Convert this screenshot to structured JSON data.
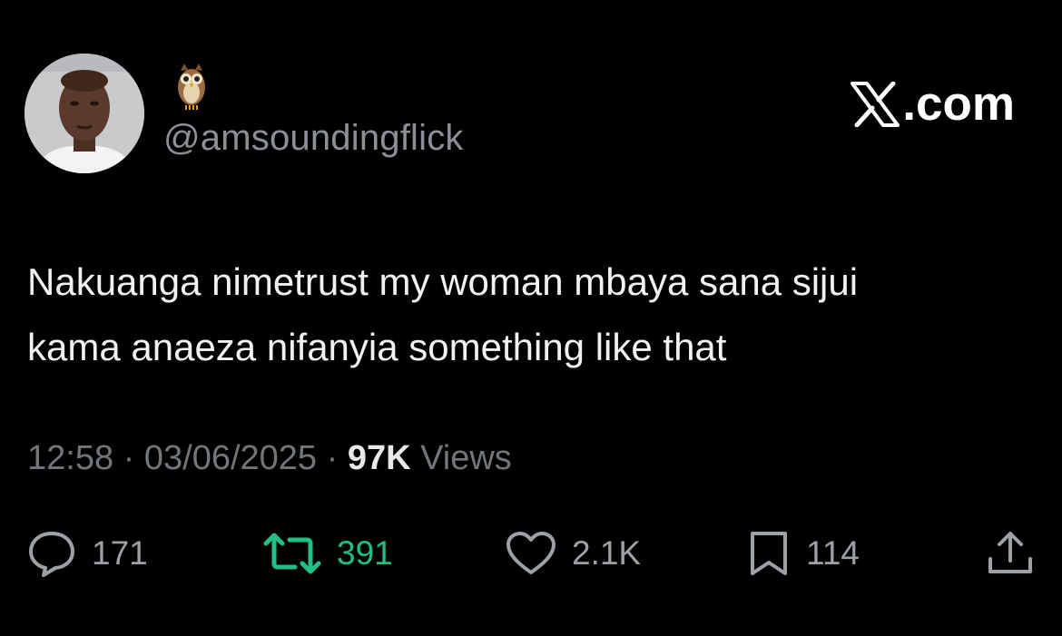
{
  "author": {
    "handle": "@amsoundingflick",
    "name_icon": "owl-emoji",
    "avatar": "avatar-photo"
  },
  "brand": {
    "logo_icon": "x-logo",
    "suffix": ".com"
  },
  "tweet": {
    "lines": [
      "Nakuanga nimetrust my woman mbaya sana sijui",
      "kama anaeza nifanyia something like that"
    ]
  },
  "meta": {
    "time": "12:58",
    "separator": " · ",
    "date": "03/06/2025",
    "views_count": "97K",
    "views_label": "Views"
  },
  "actions": {
    "replies": "171",
    "retweets": "391",
    "likes": "2.1K",
    "bookmarks": "114"
  },
  "colors": {
    "background": "#000000",
    "text": "#e7e9ea",
    "muted": "#71767b",
    "retweet_accent": "#1fbf86"
  }
}
